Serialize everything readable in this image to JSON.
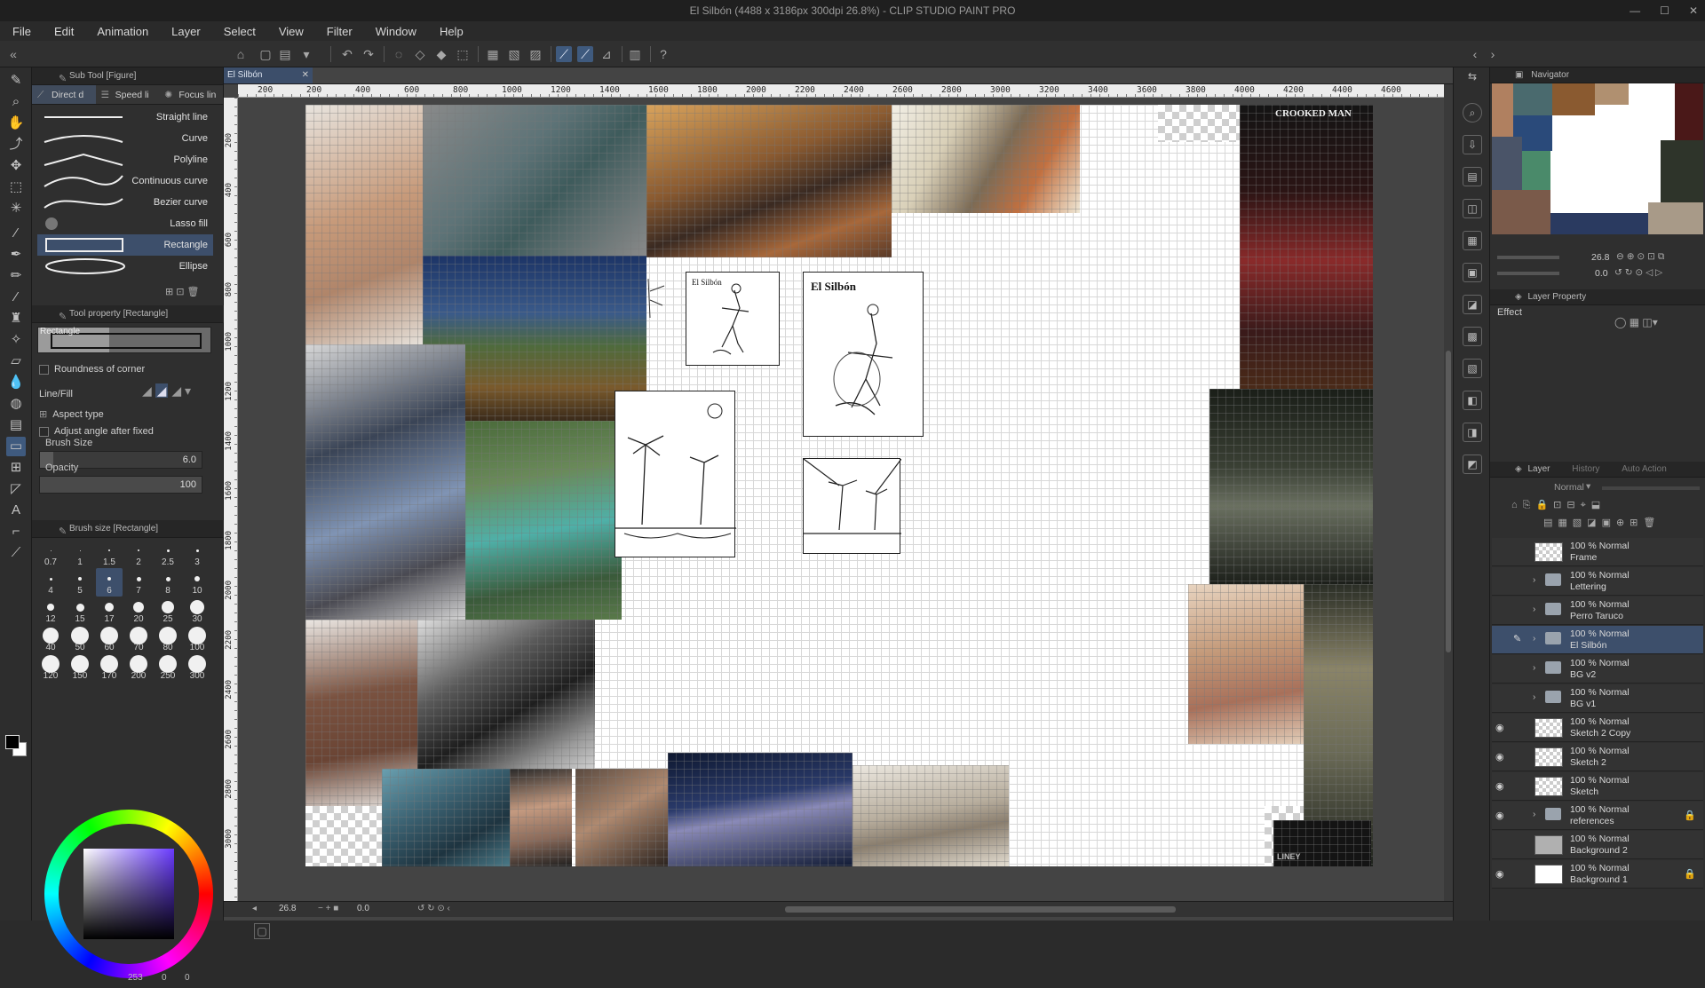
{
  "app": {
    "title": "El Silbón (4488 x 3186px 300dpi 26.8%) - CLIP STUDIO PAINT PRO",
    "window_buttons": [
      "—",
      "☐",
      "✕"
    ]
  },
  "menu": [
    "File",
    "Edit",
    "Animation",
    "Layer",
    "Select",
    "View",
    "Filter",
    "Window",
    "Help"
  ],
  "subtool": {
    "header": "Sub Tool [Figure]",
    "tabs": [
      "Direct d",
      "Speed li",
      "Focus lin"
    ],
    "items": [
      "Straight line",
      "Curve",
      "Polyline",
      "Continuous curve",
      "Bezier curve",
      "Lasso fill",
      "Rectangle",
      "Ellipse"
    ],
    "selected": "Rectangle"
  },
  "tool_property": {
    "header": "Tool property [Rectangle]",
    "preview_label": "Rectangle",
    "roundness_label": "Roundness of corner",
    "linefill_label": "Line/Fill",
    "aspect_label": "Aspect type",
    "adjust_angle_label": "Adjust angle after fixed",
    "brush_size_label": "Brush Size",
    "brush_size_value": "6.0",
    "opacity_label": "Opacity",
    "opacity_value": "100"
  },
  "brush_size": {
    "header": "Brush size [Rectangle]",
    "sizes": [
      "0.7",
      "1",
      "1.5",
      "2",
      "2.5",
      "3",
      "4",
      "5",
      "6",
      "7",
      "8",
      "10",
      "12",
      "15",
      "17",
      "20",
      "25",
      "30",
      "40",
      "50",
      "60",
      "70",
      "80",
      "100",
      "120",
      "150",
      "170",
      "200",
      "250",
      "300"
    ],
    "selected": "6"
  },
  "color": {
    "status_values": [
      "253",
      "0",
      "0"
    ],
    "accent": "#3d4f6b"
  },
  "document": {
    "tab_label": "El Silbón",
    "ruler_labels": [
      "200",
      "200",
      "400",
      "600",
      "800",
      "1000",
      "1200",
      "1400",
      "1600",
      "1800",
      "2000",
      "2200",
      "2400",
      "2600",
      "2800",
      "3000",
      "3200",
      "3400",
      "3600",
      "3800",
      "4000",
      "4200",
      "4400",
      "4600"
    ],
    "vruler_labels": [
      "200",
      "400",
      "600",
      "800",
      "1000",
      "1200",
      "1400",
      "1600",
      "1800",
      "2000",
      "2200",
      "2400",
      "2600",
      "2800",
      "3000"
    ],
    "zoom": "26.8",
    "rotation": "0.0",
    "sketch_titles": [
      "El Silbón",
      "El Silbón"
    ],
    "poster_text": "CROOKED MAN",
    "corner_badge": "LINEY"
  },
  "navigator": {
    "header": "Navigator",
    "zoom": "26.8",
    "rotation": "0.0"
  },
  "layer_property": {
    "header": "Layer Property",
    "effect_label": "Effect"
  },
  "layers_panel": {
    "tabs": [
      "Layer",
      "History",
      "Auto Action"
    ],
    "blend_mode": "Normal",
    "layers": [
      {
        "l1": "100 % Normal",
        "l2": "Frame",
        "kind": "frame"
      },
      {
        "l1": "100 % Normal",
        "l2": "Lettering",
        "kind": "folder"
      },
      {
        "l1": "100 % Normal",
        "l2": "Perro Taruco",
        "kind": "folder"
      },
      {
        "l1": "100 % Normal",
        "l2": "El Silbón",
        "kind": "folder",
        "selected": true
      },
      {
        "l1": "100 % Normal",
        "l2": "BG v2",
        "kind": "folder"
      },
      {
        "l1": "100 % Normal",
        "l2": "BG v1",
        "kind": "folder"
      },
      {
        "l1": "100 % Normal",
        "l2": "Sketch 2 Copy",
        "kind": "raster",
        "visible": true
      },
      {
        "l1": "100 % Normal",
        "l2": "Sketch 2",
        "kind": "raster",
        "visible": true
      },
      {
        "l1": "100 % Normal",
        "l2": "Sketch",
        "kind": "raster",
        "visible": true
      },
      {
        "l1": "100 % Normal",
        "l2": "references",
        "kind": "folder",
        "visible": true,
        "locked": true
      },
      {
        "l1": "100 % Normal",
        "l2": "Background 2",
        "kind": "gray"
      },
      {
        "l1": "100 % Normal",
        "l2": "Background 1",
        "kind": "white",
        "visible": true,
        "locked": true
      }
    ]
  }
}
